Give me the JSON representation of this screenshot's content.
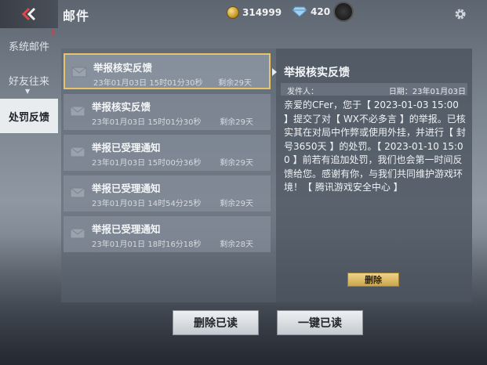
{
  "header": {
    "title": "邮件",
    "coins": "314999",
    "gems": "420",
    "icons": [
      "back-icon",
      "coin-icon",
      "gem-icon",
      "avatar",
      "gear-icon"
    ]
  },
  "sidebar": {
    "items": [
      {
        "label": "系统邮件",
        "badge": "!"
      },
      {
        "label": "好友往来"
      },
      {
        "label": "处罚反馈"
      }
    ],
    "active": "处罚反馈"
  },
  "mail_list": [
    {
      "title": "举报核实反馈",
      "date": "23年01月03日 15时01分30秒",
      "remain": "剩余29天"
    },
    {
      "title": "举报核实反馈",
      "date": "23年01月03日 15时01分30秒",
      "remain": "剩余29天"
    },
    {
      "title": "举报已受理通知",
      "date": "23年01月03日 15时00分36秒",
      "remain": "剩余29天"
    },
    {
      "title": "举报已受理通知",
      "date": "23年01月03日 14时54分25秒",
      "remain": "剩余29天"
    },
    {
      "title": "举报已受理通知",
      "date": "23年01月01日 18时16分18秒",
      "remain": "剩余28天"
    }
  ],
  "detail": {
    "title": "举报核实反馈",
    "sender_label": "发件人：",
    "date_label": "日期：23年01月03日",
    "body": "亲爱的CFer，您于【 2023-01-03 15:00 】提交了对【 WX不必多言 】的举报。已核实其在对局中作弊或使用外挂，并进行【 封号3650天 】的处罚。【 2023-01-10 15:00 】前若有追加处罚，我们也会第一时间反馈给您。感谢有你，与我们共同维护游戏环境！【 腾讯游戏安全中心 】",
    "delete_label": "删除"
  },
  "actions": {
    "delete_read": "删除已读",
    "mark_all_read": "一键已读"
  },
  "colors": {
    "selected_border": "#e6c46a",
    "delete_button": "#e2c26f",
    "badge": "#e33333"
  }
}
